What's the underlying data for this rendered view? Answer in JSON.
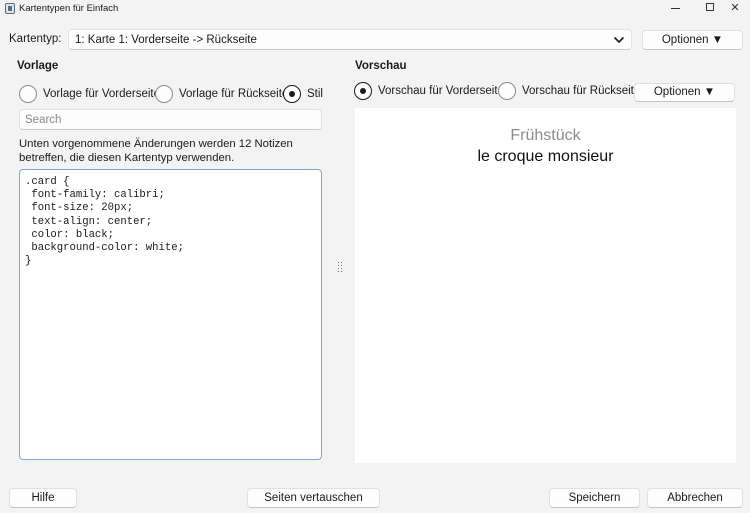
{
  "window": {
    "title": "Kartentypen für Einfach",
    "controls": {
      "minimize": "",
      "maximize": "",
      "close": "✕"
    }
  },
  "card_type": {
    "label": "Kartentyp:",
    "selected": "1: Karte 1: Vorderseite -> Rückseite",
    "options_button": "Optionen ▼"
  },
  "template": {
    "section_title": "Vorlage",
    "radios": [
      {
        "label": "Vorlage für Vorderseite",
        "checked": false
      },
      {
        "label": "Vorlage für Rückseite",
        "checked": false
      },
      {
        "label": "Stil",
        "checked": true
      }
    ],
    "search_placeholder": "Search",
    "notice": "Unten vorgenommene Änderungen werden 12 Notizen betreffen, die diesen Kartentyp verwenden.",
    "editor_content": ".card {\n font-family: calibri;\n font-size: 20px;\n text-align: center;\n color: black;\n background-color: white;\n}"
  },
  "preview": {
    "section_title": "Vorschau",
    "radios": [
      {
        "label": "Vorschau für Vorderseite",
        "checked": true
      },
      {
        "label": "Vorschau für Rückseite",
        "checked": false
      }
    ],
    "options_button": "Optionen ▼",
    "front_text": "Frühstück",
    "back_text": "le croque monsieur"
  },
  "footer": {
    "help": "Hilfe",
    "swap": "Seiten vertauschen",
    "save": "Speichern",
    "cancel": "Abbrechen"
  },
  "colors": {
    "editor_border": "#7ba7d6",
    "front_text": "#8c8c8c",
    "background": "#f3f3f3"
  }
}
